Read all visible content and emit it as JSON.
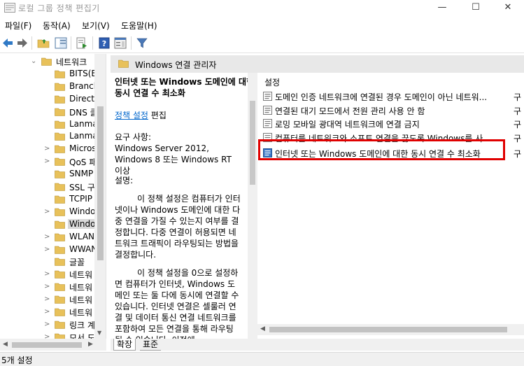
{
  "window": {
    "title": "로컬 그룹 정책 편집기",
    "minimize": "—",
    "maximize": "☐",
    "close": "✕"
  },
  "menu": {
    "items": [
      "파일(F)",
      "동작(A)",
      "보기(V)",
      "도움말(H)"
    ]
  },
  "toolbar": {
    "icons": [
      "back-arrow-icon",
      "forward-arrow-icon",
      "up-folder-icon",
      "show-hide-tree-icon",
      "export-list-icon",
      "help-icon",
      "properties-icon",
      "filter-icon"
    ]
  },
  "tree": {
    "items": [
      {
        "label": "네트워크",
        "expanded": true,
        "selected": false
      },
      {
        "label": "BITS(B",
        "expanded": false,
        "selected": false
      },
      {
        "label": "Branch",
        "expanded": false,
        "selected": false
      },
      {
        "label": "Direct",
        "expanded": false,
        "selected": false
      },
      {
        "label": "DNS 클",
        "expanded": false,
        "selected": false
      },
      {
        "label": "Lanma",
        "expanded": false,
        "selected": false
      },
      {
        "label": "Lanma",
        "expanded": false,
        "selected": false
      },
      {
        "label": "Micros",
        "expanded": false,
        "selected": false
      },
      {
        "label": "QoS 패",
        "expanded": false,
        "selected": false
      },
      {
        "label": "SNMP",
        "expanded": false,
        "selected": false
      },
      {
        "label": "SSL 구",
        "expanded": false,
        "selected": false
      },
      {
        "label": "TCPIP",
        "expanded": false,
        "selected": false
      },
      {
        "label": "Windo",
        "expanded": false,
        "selected": false
      },
      {
        "label": "Windo",
        "expanded": false,
        "selected": true
      },
      {
        "label": "WLAN",
        "expanded": false,
        "selected": false
      },
      {
        "label": "WWAN",
        "expanded": false,
        "selected": false
      },
      {
        "label": "글꼴",
        "expanded": false,
        "selected": false
      },
      {
        "label": "네트워",
        "expanded": false,
        "selected": false
      },
      {
        "label": "네트워",
        "expanded": false,
        "selected": false
      },
      {
        "label": "네트워",
        "expanded": false,
        "selected": false
      },
      {
        "label": "네트워",
        "expanded": false,
        "selected": false
      },
      {
        "label": "링크 계",
        "expanded": false,
        "selected": false
      },
      {
        "label": "모서 도",
        "expanded": false,
        "selected": false
      }
    ]
  },
  "header": {
    "title": "Windows 연결 관리자"
  },
  "description": {
    "title": "인터넷 또는 Windows 도메인에 대한 동시 연결 수 최소화",
    "edit_link": "정책 설정",
    "edit_suffix": " 편집",
    "requirements_label": "요구 사항:",
    "requirements_text": "Windows Server 2012, Windows 8 또는 Windows RT 이상",
    "desc_label": "설명:",
    "paragraph1": "이 정책 설정은 컴퓨터가 인터넷이나 Windows 도메인에 대한 다중 연결을 가질 수 있는지 여부를 결정합니다. 다중 연결이 허용되면 네트워크 트래픽이 라우팅되는 방법을 결정합니다.",
    "paragraph2": "이 정책 설정을 0으로 설정하면 컴퓨터가 인터넷, Windows 도메인 또는 둘 다에 동시에 연결할 수 있습니다. 인터넷 연결은 셀룰러 연결 및 데이터 통신 연결 네트워크를 포함하여 모든 연결을 통해 라우팅될 수 있습니다. 이전에"
  },
  "list": {
    "column_header": "설정",
    "state_col": "구",
    "rows": [
      {
        "text": "도메인 인증 네트워크에 연결된 경우 도메인이 아닌 네트워...",
        "state": "구",
        "selected": false
      },
      {
        "text": "연결된 대기 모드에서 전원 관리 사용 안 함",
        "state": "구",
        "selected": false
      },
      {
        "text": "로밍 모바일 광대역 네트워크에 연결 금지",
        "state": "구",
        "selected": false
      },
      {
        "text": "컴퓨터를 네트워크와 소프트 연결을 끊도록 Windows를 사...",
        "state": "구",
        "selected": false
      },
      {
        "text": "인터넷 또는 Windows 도메인에 대한 동시 연결 수 최소화",
        "state": "구",
        "selected": true
      }
    ]
  },
  "tabs": {
    "extended": "확장",
    "standard": "표준"
  },
  "status": {
    "text": "5개 설정"
  },
  "colors": {
    "highlight_border": "#e00000",
    "link": "#0066cc",
    "folder": "#e8c15a"
  }
}
